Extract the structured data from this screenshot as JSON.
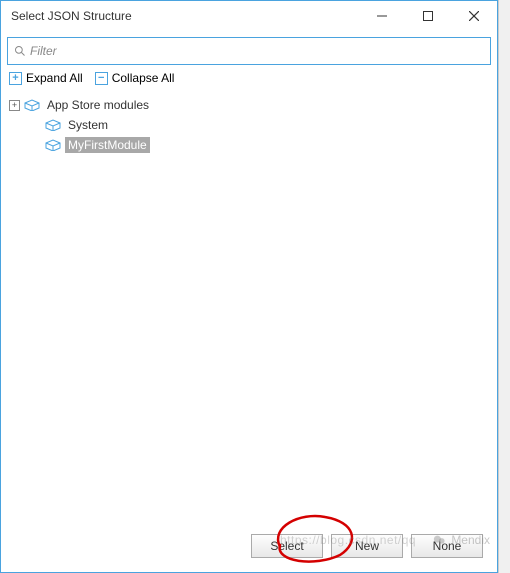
{
  "window": {
    "title": "Select JSON Structure"
  },
  "filter": {
    "placeholder": "Filter",
    "value": ""
  },
  "toolbar": {
    "expand_label": "Expand All",
    "collapse_label": "Collapse All"
  },
  "tree": {
    "items": [
      {
        "label": "App Store modules",
        "depth": 0,
        "expandable": true,
        "expanded": true,
        "selected": false
      },
      {
        "label": "System",
        "depth": 1,
        "expandable": false,
        "selected": false
      },
      {
        "label": "MyFirstModule",
        "depth": 1,
        "expandable": false,
        "selected": true
      }
    ]
  },
  "footer": {
    "select_label": "Select",
    "new_label": "New",
    "none_label": "None"
  },
  "watermark": {
    "text": "https://blog.csdn.net/qq",
    "brand": "Mendix"
  },
  "annotation": {
    "circled": "new_button"
  }
}
